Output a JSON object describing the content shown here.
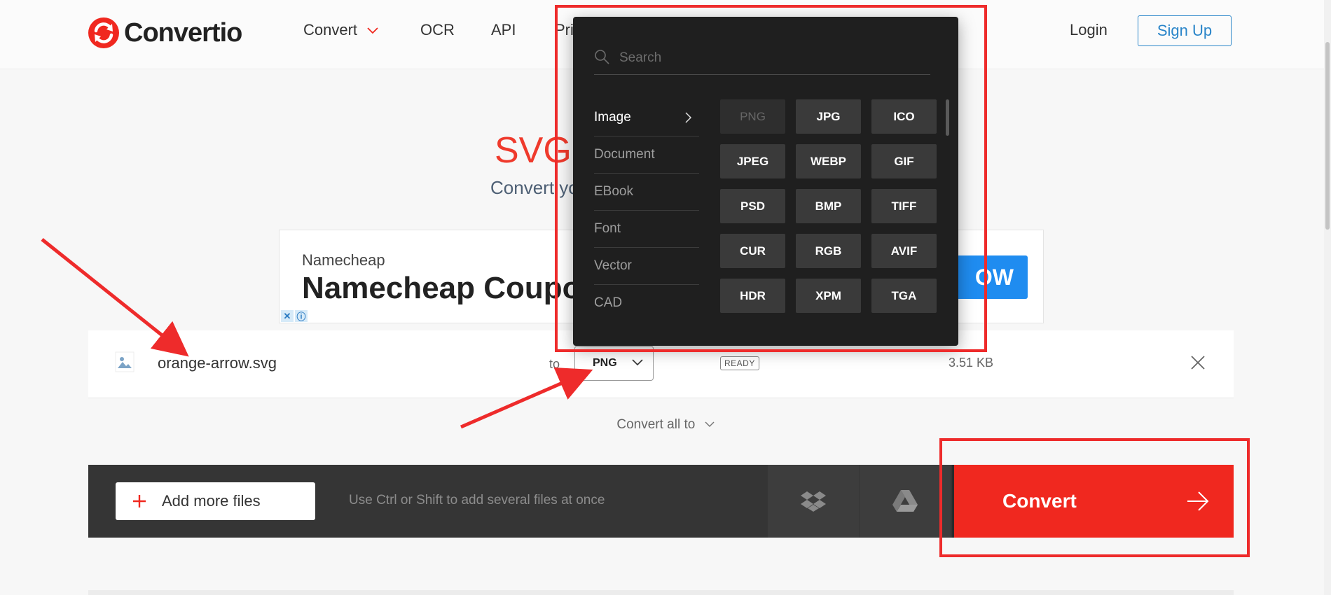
{
  "header": {
    "logo_text": "Convertio",
    "nav": [
      {
        "label": "Convert"
      },
      {
        "label": "OCR"
      },
      {
        "label": "API"
      },
      {
        "label": "Pri"
      }
    ],
    "login_label": "Login",
    "signup_label": "Sign Up"
  },
  "hero": {
    "title": "SVG t",
    "subtitle": "Convert yo"
  },
  "ad": {
    "advertiser": "Namecheap",
    "headline": "Namecheap Coupo",
    "cta": "OW"
  },
  "file": {
    "name": "orange-arrow.svg",
    "to_label": "to",
    "format": "PNG",
    "status": "READY",
    "size": "3.51 KB"
  },
  "convert_all": {
    "label": "Convert all to"
  },
  "toolbar": {
    "add_more_label": "Add more files",
    "hint": "Use Ctrl or Shift to add several files at once",
    "convert_label": "Convert"
  },
  "dropdown": {
    "search_placeholder": "Search",
    "categories": [
      {
        "label": "Image"
      },
      {
        "label": "Document"
      },
      {
        "label": "EBook"
      },
      {
        "label": "Font"
      },
      {
        "label": "Vector"
      },
      {
        "label": "CAD"
      }
    ],
    "formats": [
      "PNG",
      "JPG",
      "ICO",
      "JPEG",
      "WEBP",
      "GIF",
      "PSD",
      "BMP",
      "TIFF",
      "CUR",
      "RGB",
      "AVIF",
      "HDR",
      "XPM",
      "TGA"
    ],
    "selected_format": "PNG",
    "active_category": "Image"
  },
  "colors": {
    "brand_red": "#f0281f",
    "annotation_red": "#ee2b2b",
    "signup_blue": "#2a85c9",
    "dropdown_bg": "#1f1f1f"
  }
}
